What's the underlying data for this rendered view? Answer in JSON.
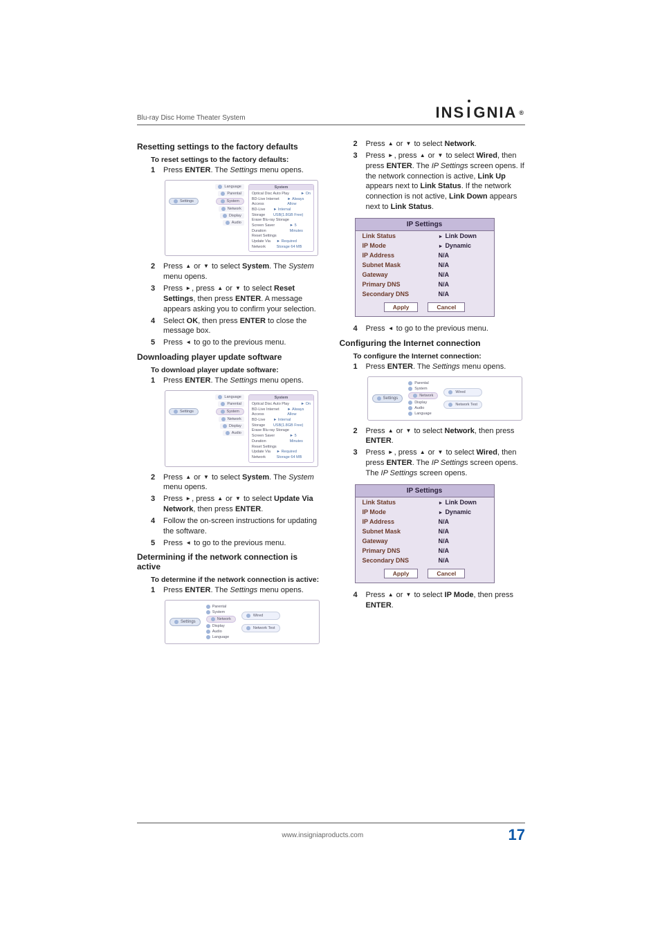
{
  "header": {
    "doc_title": "Blu-ray Disc Home Theater System",
    "brand": "INSIGNIA"
  },
  "glyph": {
    "up": "▲",
    "down": "▼",
    "left": "◄",
    "right": "►"
  },
  "sections": {
    "reset": {
      "title": "Resetting settings to the factory defaults",
      "sub": "To reset settings to the factory defaults:",
      "steps": [
        {
          "n": "1",
          "parts": [
            "Press ",
            {
              "b": "ENTER"
            },
            ". The ",
            {
              "i": "Settings"
            },
            " menu opens."
          ]
        },
        {
          "n": "2",
          "parts": [
            "Press ",
            {
              "g": "up"
            },
            " or ",
            {
              "g": "down"
            },
            " to select ",
            {
              "b": "System"
            },
            ". The ",
            {
              "i": "System"
            },
            " menu opens."
          ]
        },
        {
          "n": "3",
          "parts": [
            "Press ",
            {
              "g": "right"
            },
            ", press ",
            {
              "g": "up"
            },
            " or ",
            {
              "g": "down"
            },
            " to select ",
            {
              "b": "Reset Settings"
            },
            ", then press ",
            {
              "b": "ENTER"
            },
            ". A message appears asking you to confirm your selection."
          ]
        },
        {
          "n": "4",
          "parts": [
            "Select ",
            {
              "b": "OK"
            },
            ", then press ",
            {
              "b": "ENTER"
            },
            " to close the message box."
          ]
        },
        {
          "n": "5",
          "parts": [
            "Press ",
            {
              "g": "left"
            },
            " to go to the previous menu."
          ]
        }
      ]
    },
    "download": {
      "title": "Downloading player update software",
      "sub": "To download player update software:",
      "steps": [
        {
          "n": "1",
          "parts": [
            "Press ",
            {
              "b": "ENTER"
            },
            ". The ",
            {
              "i": "Settings"
            },
            " menu opens."
          ]
        },
        {
          "n": "2",
          "parts": [
            "Press ",
            {
              "g": "up"
            },
            " or ",
            {
              "g": "down"
            },
            " to select ",
            {
              "b": "System"
            },
            ". The ",
            {
              "i": "System"
            },
            " menu opens."
          ]
        },
        {
          "n": "3",
          "parts": [
            "Press ",
            {
              "g": "right"
            },
            ", press ",
            {
              "g": "up"
            },
            " or ",
            {
              "g": "down"
            },
            " to select ",
            {
              "b": "Update Via Network"
            },
            ", then press ",
            {
              "b": "ENTER"
            },
            "."
          ]
        },
        {
          "n": "4",
          "parts": [
            "Follow the on-screen instructions for updating the software."
          ]
        },
        {
          "n": "5",
          "parts": [
            "Press ",
            {
              "g": "left"
            },
            " to go to the previous menu."
          ]
        }
      ]
    },
    "determine": {
      "title": "Determining if the network connection is active",
      "sub": "To determine if the network connection is active:",
      "steps": [
        {
          "n": "1",
          "parts": [
            "Press ",
            {
              "b": "ENTER"
            },
            ". The ",
            {
              "i": "Settings"
            },
            " menu opens."
          ]
        }
      ]
    },
    "det_cont": [
      {
        "n": "2",
        "parts": [
          "Press ",
          {
            "g": "up"
          },
          " or ",
          {
            "g": "down"
          },
          " to select ",
          {
            "b": "Network"
          },
          "."
        ]
      },
      {
        "n": "3",
        "parts": [
          "Press ",
          {
            "g": "right"
          },
          ", press ",
          {
            "g": "up"
          },
          " or ",
          {
            "g": "down"
          },
          " to select ",
          {
            "b": "Wired"
          },
          ", then press ",
          {
            "b": "ENTER"
          },
          ". The ",
          {
            "i": "IP Settings"
          },
          " screen opens. If the network connection is active, ",
          {
            "b": "Link Up"
          },
          " appears next to ",
          {
            "b": "Link Status"
          },
          ". If the network connection is not active, ",
          {
            "b": "Link Down"
          },
          " appears next to ",
          {
            "b": "Link Status"
          },
          "."
        ]
      },
      {
        "n": "4",
        "parts": [
          "Press ",
          {
            "g": "left"
          },
          " to go to the previous menu."
        ]
      }
    ],
    "configure": {
      "title": "Configuring the Internet connection",
      "sub": "To configure the Internet connection:",
      "steps": [
        {
          "n": "1",
          "parts": [
            "Press ",
            {
              "b": "ENTER"
            },
            ". The ",
            {
              "i": "Settings"
            },
            " menu opens."
          ]
        },
        {
          "n": "2",
          "parts": [
            "Press ",
            {
              "g": "up"
            },
            " or ",
            {
              "g": "down"
            },
            " to select ",
            {
              "b": "Network"
            },
            ", then press ",
            {
              "b": "ENTER"
            },
            "."
          ]
        },
        {
          "n": "3",
          "parts": [
            "Press ",
            {
              "g": "right"
            },
            ", press ",
            {
              "g": "up"
            },
            " or ",
            {
              "g": "down"
            },
            " to select ",
            {
              "b": "Wired"
            },
            ", then press ",
            {
              "b": "ENTER"
            },
            ". The ",
            {
              "i": "IP Settings"
            },
            " screen opens. The ",
            {
              "i": "IP Settings"
            },
            " screen opens."
          ]
        },
        {
          "n": "4",
          "parts": [
            "Press ",
            {
              "g": "up"
            },
            " or ",
            {
              "g": "down"
            },
            " to select ",
            {
              "b": "IP Mode"
            },
            ", then press ",
            {
              "b": "ENTER"
            },
            "."
          ]
        }
      ]
    }
  },
  "ui_sys": {
    "settings": "Settings",
    "side": [
      "Language",
      "Parental",
      "System",
      "Network",
      "Display",
      "Audio"
    ],
    "panel_title": "System",
    "rows": [
      {
        "k": "Optical Disc Auto Play",
        "v": "On",
        "p": "►"
      },
      {
        "k": "BD-Live Internet Access",
        "v": "Always Allow",
        "p": "►"
      },
      {
        "k": "BD-Live Storage",
        "v": "Internal USB(1.8GB Free)",
        "p": "►"
      },
      {
        "k": "Erase Blu-ray Storage",
        "v": ""
      },
      {
        "k": "Screen Saver Duration",
        "v": "5 Minutes",
        "p": "►"
      },
      {
        "k": "Reset Settings",
        "v": ""
      },
      {
        "k": "Update Via Network",
        "v": "Required Storage 64 MB",
        "p": "►"
      }
    ]
  },
  "ui_net": {
    "settings": "Settings",
    "side": [
      "Parental",
      "System",
      "Network",
      "Display",
      "Audio",
      "Language"
    ],
    "opts": [
      "Wired",
      "Network Test"
    ]
  },
  "ip": {
    "title": "IP Settings",
    "rows": [
      {
        "k": "Link Status",
        "v": "Link Down",
        "p": "►"
      },
      {
        "k": "IP Mode",
        "v": "Dynamic",
        "p": "►"
      },
      {
        "k": "IP Address",
        "v": "N/A"
      },
      {
        "k": "Subnet Mask",
        "v": "N/A"
      },
      {
        "k": "Gateway",
        "v": "N/A"
      },
      {
        "k": "Primary DNS",
        "v": "N/A"
      },
      {
        "k": "Secondary DNS",
        "v": "N/A"
      }
    ],
    "apply": "Apply",
    "cancel": "Cancel"
  },
  "footer": {
    "url": "www.insigniaproducts.com",
    "page": "17"
  }
}
